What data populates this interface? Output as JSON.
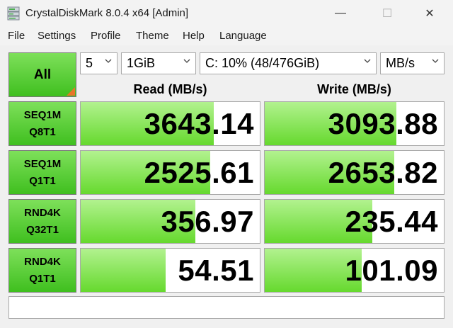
{
  "window": {
    "title": "CrystalDiskMark 8.0.4 x64 [Admin]",
    "min_glyph": "—",
    "max_glyph": "☐",
    "close_glyph": "✕"
  },
  "menu": [
    "File",
    "Settings",
    "Profile",
    "Theme",
    "Help",
    "Language"
  ],
  "controls": {
    "all_label": "All",
    "count": "5",
    "size": "1GiB",
    "drive": "C: 10% (48/476GiB)",
    "unit": "MB/s"
  },
  "columns": {
    "read": "Read (MB/s)",
    "write": "Write (MB/s)"
  },
  "tests": [
    {
      "line1": "SEQ1M",
      "line2": "Q8T1",
      "read": "3643.14",
      "write": "3093.88",
      "read_fill": 0.745,
      "write_fill": 0.735
    },
    {
      "line1": "SEQ1M",
      "line2": "Q1T1",
      "read": "2525.61",
      "write": "2653.82",
      "read_fill": 0.725,
      "write_fill": 0.725
    },
    {
      "line1": "RND4K",
      "line2": "Q32T1",
      "read": "356.97",
      "write": "235.44",
      "read_fill": 0.64,
      "write_fill": 0.6
    },
    {
      "line1": "RND4K",
      "line2": "Q1T1",
      "read": "54.51",
      "write": "101.09",
      "read_fill": 0.475,
      "write_fill": 0.54
    }
  ],
  "colors": {
    "bar_green": "#66d92e",
    "button_green": "#3fbf1f",
    "corner_orange": "#e8762a"
  }
}
